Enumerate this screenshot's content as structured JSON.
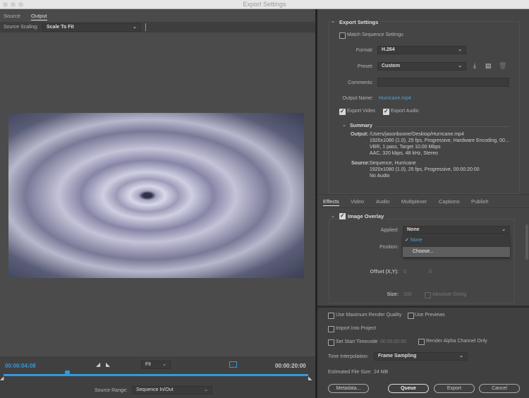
{
  "window": {
    "title": "Export Settings"
  },
  "left": {
    "tabs": [
      {
        "label": "Source"
      },
      {
        "label": "Output"
      }
    ],
    "source_scaling_label": "Source Scaling:",
    "source_scaling_value": "Scale To Fit",
    "current_time": "00:00:04:08",
    "duration": "00:00:20:00",
    "zoom_value": "Fit",
    "source_range_label": "Source Range:",
    "source_range_value": "Sequence In/Out",
    "playhead_fraction": 0.21
  },
  "export_settings": {
    "heading": "Export Settings",
    "match_sequence": "Match Sequence Settings",
    "format_label": "Format:",
    "format_value": "H.264",
    "preset_label": "Preset:",
    "preset_value": "Custom",
    "comments_label": "Comments:",
    "comments_value": "",
    "output_name_label": "Output Name:",
    "output_name_value": "Hurricane.mp4",
    "export_video": "Export Video",
    "export_audio": "Export Audio",
    "summary_heading": "Summary",
    "output_label": "Output:",
    "output_lines": [
      "/Users/jasonboone/Desktop/Hurricane.mp4",
      "1920x1080 (1.0), 25 fps, Progressive, Hardware Encoding, 00...",
      "VBR, 1 pass, Target 10.00 Mbps",
      "AAC, 320 kbps, 48 kHz, Stereo"
    ],
    "source_label": "Source:",
    "source_lines": [
      "Sequence, Hurricane",
      "1920x1080 (1.0), 25 fps, Progressive, 00:00:20:00",
      "No Audio"
    ]
  },
  "effects": {
    "tabs": [
      {
        "label": "Effects"
      },
      {
        "label": "Video"
      },
      {
        "label": "Audio"
      },
      {
        "label": "Multiplexer"
      },
      {
        "label": "Captions"
      },
      {
        "label": "Publish"
      }
    ],
    "image_overlay": "Image Overlay",
    "applied_label": "Applied:",
    "applied_value": "None",
    "dropdown_options": [
      {
        "label": "None"
      },
      {
        "label": "Choose..."
      }
    ],
    "position_label": "Position:",
    "offset_label": "Offset (X,Y):",
    "offset_x": "0",
    "offset_y": "0",
    "size_label": "Size:",
    "size_value": "100",
    "absolute_sizing": "Absolute Sizing"
  },
  "bottom": {
    "max_render": "Use Maximum Render Quality",
    "use_previews": "Use Previews",
    "import_project": "Import Into Project",
    "start_timecode": "Set Start Timecode",
    "start_timecode_value": "00:00:00:00",
    "render_alpha": "Render Alpha Channel Only",
    "time_interp_label": "Time Interpolation:",
    "time_interp_value": "Frame Sampling",
    "file_size_label": "Estimated File Size:",
    "file_size_value": "24 MB",
    "metadata": "Metadata...",
    "queue": "Queue",
    "export": "Export",
    "cancel": "Cancel"
  },
  "colors": {
    "accent": "#2d9ae0",
    "link": "#4aa3e0"
  }
}
